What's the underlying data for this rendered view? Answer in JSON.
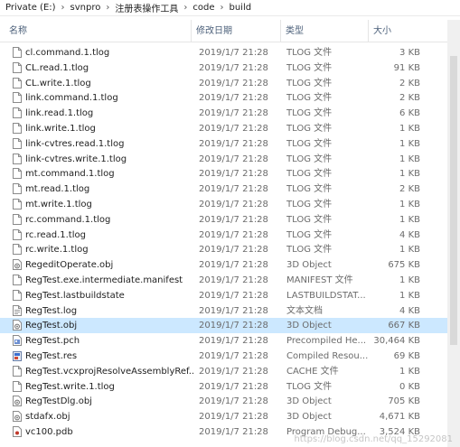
{
  "breadcrumb": [
    "Private (E:)",
    "svnpro",
    "注册表操作工具",
    "code",
    "build"
  ],
  "breadcrumb_separator": "›",
  "columns": {
    "name": "名称",
    "date": "修改日期",
    "type": "类型",
    "size": "大小"
  },
  "files": [
    {
      "name": "cl.command.1.tlog",
      "date": "2019/1/7 21:28",
      "type": "TLOG 文件",
      "size": "3 KB",
      "icon": "document-icon"
    },
    {
      "name": "CL.read.1.tlog",
      "date": "2019/1/7 21:28",
      "type": "TLOG 文件",
      "size": "91 KB",
      "icon": "document-icon"
    },
    {
      "name": "CL.write.1.tlog",
      "date": "2019/1/7 21:28",
      "type": "TLOG 文件",
      "size": "2 KB",
      "icon": "document-icon"
    },
    {
      "name": "link.command.1.tlog",
      "date": "2019/1/7 21:28",
      "type": "TLOG 文件",
      "size": "2 KB",
      "icon": "document-icon"
    },
    {
      "name": "link.read.1.tlog",
      "date": "2019/1/7 21:28",
      "type": "TLOG 文件",
      "size": "6 KB",
      "icon": "document-icon"
    },
    {
      "name": "link.write.1.tlog",
      "date": "2019/1/7 21:28",
      "type": "TLOG 文件",
      "size": "1 KB",
      "icon": "document-icon"
    },
    {
      "name": "link-cvtres.read.1.tlog",
      "date": "2019/1/7 21:28",
      "type": "TLOG 文件",
      "size": "1 KB",
      "icon": "document-icon"
    },
    {
      "name": "link-cvtres.write.1.tlog",
      "date": "2019/1/7 21:28",
      "type": "TLOG 文件",
      "size": "1 KB",
      "icon": "document-icon"
    },
    {
      "name": "mt.command.1.tlog",
      "date": "2019/1/7 21:28",
      "type": "TLOG 文件",
      "size": "1 KB",
      "icon": "document-icon"
    },
    {
      "name": "mt.read.1.tlog",
      "date": "2019/1/7 21:28",
      "type": "TLOG 文件",
      "size": "2 KB",
      "icon": "document-icon"
    },
    {
      "name": "mt.write.1.tlog",
      "date": "2019/1/7 21:28",
      "type": "TLOG 文件",
      "size": "1 KB",
      "icon": "document-icon"
    },
    {
      "name": "rc.command.1.tlog",
      "date": "2019/1/7 21:28",
      "type": "TLOG 文件",
      "size": "1 KB",
      "icon": "document-icon"
    },
    {
      "name": "rc.read.1.tlog",
      "date": "2019/1/7 21:28",
      "type": "TLOG 文件",
      "size": "4 KB",
      "icon": "document-icon"
    },
    {
      "name": "rc.write.1.tlog",
      "date": "2019/1/7 21:28",
      "type": "TLOG 文件",
      "size": "1 KB",
      "icon": "document-icon"
    },
    {
      "name": "RegeditOperate.obj",
      "date": "2019/1/7 21:28",
      "type": "3D Object",
      "size": "675 KB",
      "icon": "object-file-icon"
    },
    {
      "name": "RegTest.exe.intermediate.manifest",
      "date": "2019/1/7 21:28",
      "type": "MANIFEST 文件",
      "size": "1 KB",
      "icon": "document-icon"
    },
    {
      "name": "RegTest.lastbuildstate",
      "date": "2019/1/7 21:28",
      "type": "LASTBUILDSTAT...",
      "size": "1 KB",
      "icon": "document-icon"
    },
    {
      "name": "RegTest.log",
      "date": "2019/1/7 21:28",
      "type": "文本文档",
      "size": "4 KB",
      "icon": "text-file-icon"
    },
    {
      "name": "RegTest.obj",
      "date": "2019/1/7 21:28",
      "type": "3D Object",
      "size": "667 KB",
      "icon": "object-file-icon",
      "selected": true
    },
    {
      "name": "RegTest.pch",
      "date": "2019/1/7 21:28",
      "type": "Precompiled He...",
      "size": "30,464 KB",
      "icon": "precompiled-header-icon"
    },
    {
      "name": "RegTest.res",
      "date": "2019/1/7 21:28",
      "type": "Compiled Resou...",
      "size": "69 KB",
      "icon": "compiled-resource-icon"
    },
    {
      "name": "RegTest.vcxprojResolveAssemblyRef...",
      "date": "2019/1/7 21:28",
      "type": "CACHE 文件",
      "size": "1 KB",
      "icon": "document-icon"
    },
    {
      "name": "RegTest.write.1.tlog",
      "date": "2019/1/7 21:28",
      "type": "TLOG 文件",
      "size": "0 KB",
      "icon": "document-icon"
    },
    {
      "name": "RegTestDlg.obj",
      "date": "2019/1/7 21:28",
      "type": "3D Object",
      "size": "705 KB",
      "icon": "object-file-icon"
    },
    {
      "name": "stdafx.obj",
      "date": "2019/1/7 21:28",
      "type": "3D Object",
      "size": "4,671 KB",
      "icon": "object-file-icon"
    },
    {
      "name": "vc100.pdb",
      "date": "2019/1/7 21:28",
      "type": "Program Debug...",
      "size": "3,524 KB",
      "icon": "program-debug-icon"
    }
  ],
  "watermark": "https://blog.csdn.net/qq_15292081",
  "colors": {
    "selected_row": "#cce8ff",
    "header_text": "#4c607a",
    "meta_text": "#6b6b6b"
  }
}
